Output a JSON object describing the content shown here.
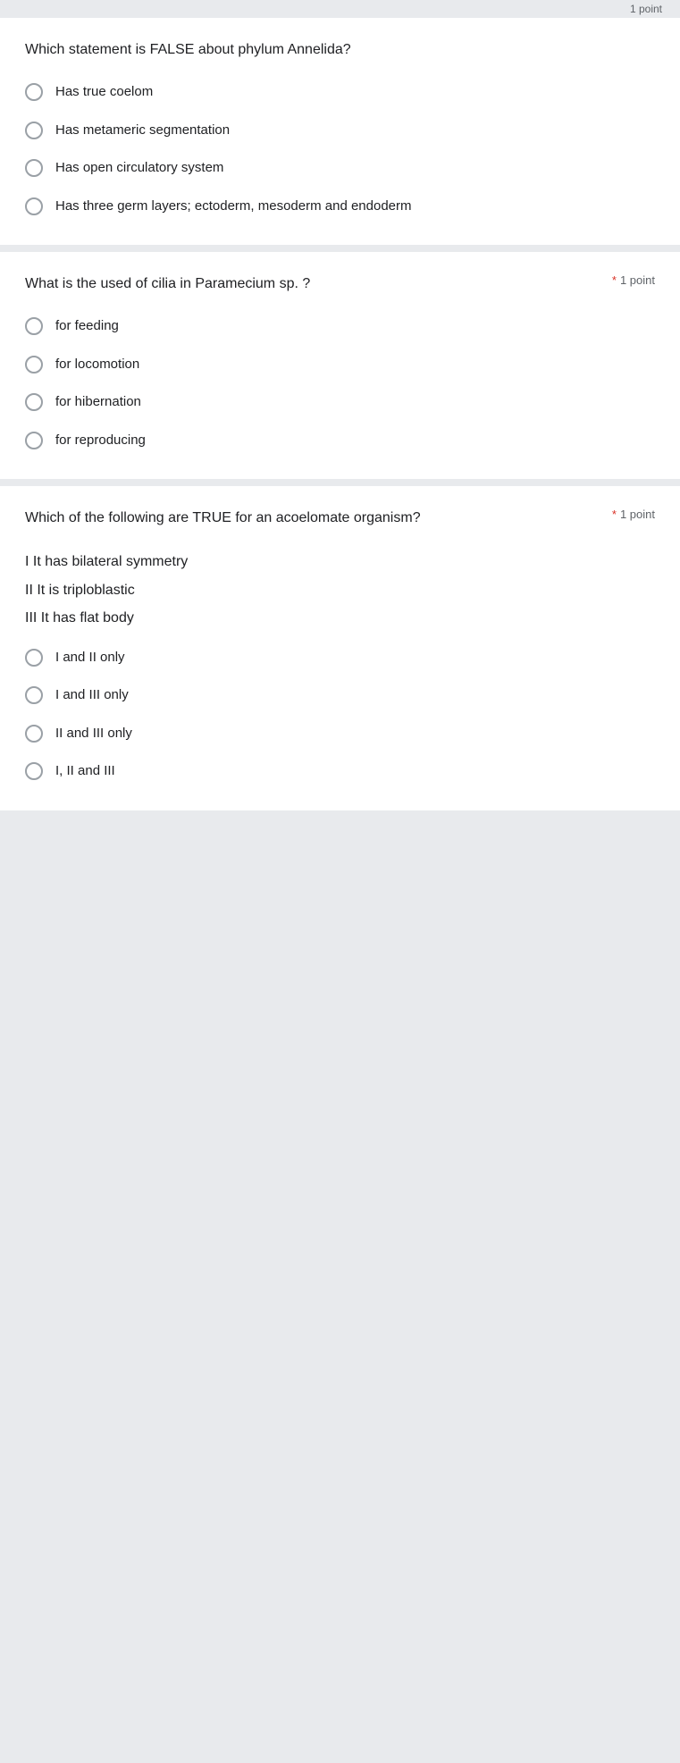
{
  "topbar": {
    "points_label": "1 point"
  },
  "question1": {
    "text": "Which statement is FALSE about phylum Annelida?",
    "required": false,
    "options": [
      {
        "id": "q1o1",
        "label": "Has true coelom"
      },
      {
        "id": "q1o2",
        "label": "Has metameric segmentation"
      },
      {
        "id": "q1o3",
        "label": "Has open circulatory system"
      },
      {
        "id": "q1o4",
        "label": "Has three germ layers; ectoderm, mesoderm and endoderm"
      }
    ]
  },
  "question2": {
    "text": "What is the used of cilia in Paramecium sp. ?",
    "required": true,
    "points_label": "1 point",
    "options": [
      {
        "id": "q2o1",
        "label": "for feeding"
      },
      {
        "id": "q2o2",
        "label": "for locomotion"
      },
      {
        "id": "q2o3",
        "label": "for hibernation"
      },
      {
        "id": "q2o4",
        "label": "for reproducing"
      }
    ]
  },
  "question3": {
    "text": "Which of the following are TRUE for an acoelomate organism?",
    "required": true,
    "points_label": "1 point",
    "statements": [
      {
        "id": "s1",
        "label": "I It has bilateral symmetry"
      },
      {
        "id": "s2",
        "label": "II It is triploblastic"
      },
      {
        "id": "s3",
        "label": "III It has flat body"
      }
    ],
    "options": [
      {
        "id": "q3o1",
        "label": "I and II only"
      },
      {
        "id": "q3o2",
        "label": "I and III only"
      },
      {
        "id": "q3o3",
        "label": "II and III only"
      },
      {
        "id": "q3o4",
        "label": "I, II and III"
      }
    ]
  }
}
